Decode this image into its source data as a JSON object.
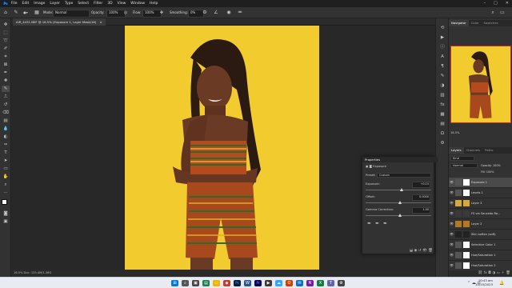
{
  "app": {
    "logo": "Ps",
    "menus": [
      "File",
      "Edit",
      "Image",
      "Layer",
      "Type",
      "Select",
      "Filter",
      "3D",
      "View",
      "Window",
      "Help"
    ],
    "window_controls": [
      "–",
      "□",
      "✕"
    ]
  },
  "options_bar": {
    "mode_label": "Mode:",
    "mode_value": "Normal",
    "opacity_label": "Opacity:",
    "opacity_value": "100%",
    "flow_label": "Flow:",
    "flow_value": "100%",
    "smoothing_label": "Smoothing:",
    "smoothing_value": "0%"
  },
  "document": {
    "tab_title": "AIR_4431.NEF @ 16.5% (Exposure 1, Layer Mask/16)",
    "status_text": "16.5%   Doc: 133.4M/1.36G"
  },
  "navigator": {
    "tabs": [
      "Navigator",
      "Color",
      "Swatches"
    ],
    "zoom": "16.5%"
  },
  "layers_panel": {
    "tabs": [
      "Layers",
      "Channels",
      "Paths"
    ],
    "kind_label": "Kind",
    "blend_mode": "Normal",
    "opacity_label": "Opacity:",
    "opacity_value": "100%",
    "fill_label": "Fill:",
    "fill_value": "100%",
    "layers": [
      {
        "name": "Exposure 1",
        "selected": true
      },
      {
        "name": "Levels 1",
        "selected": false
      },
      {
        "name": "Layer 3",
        "selected": false
      },
      {
        "name": "FS via Saucedo Ro...",
        "selected": false
      },
      {
        "name": "Layer 2",
        "selected": false
      },
      {
        "name": "Skin soften (soft)",
        "selected": false
      },
      {
        "name": "Selective Color 1",
        "selected": false
      },
      {
        "name": "Hue/Saturation 1",
        "selected": false
      },
      {
        "name": "Hue/Saturation 2",
        "selected": false
      }
    ]
  },
  "properties": {
    "title": "Properties",
    "sub_title": "Exposure",
    "preset_label": "Preset:",
    "preset_value": "Custom",
    "exposure_label": "Exposure:",
    "exposure_value": "+0.15",
    "offset_label": "Offset:",
    "offset_value": "0.0000",
    "gamma_label": "Gamma Correction:",
    "gamma_value": "1.00"
  },
  "taskbar": {
    "time": "10:43 am",
    "date": "10/15/2023",
    "colors": {
      "start": "#0078d4",
      "accent": "#31a8ff"
    }
  },
  "colors": {
    "photo_background": "#f2cb2f",
    "panel": "#323232",
    "nav_frame": "#ce2a2a"
  }
}
